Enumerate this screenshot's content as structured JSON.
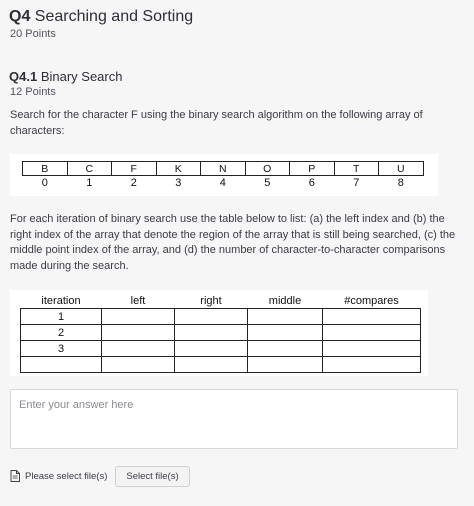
{
  "question": {
    "number": "Q4",
    "title": "Searching and Sorting",
    "points": "20 Points"
  },
  "subquestion": {
    "number": "Q4.1",
    "title": "Binary Search",
    "points": "12 Points"
  },
  "prompt_1": "Search for the character F using the binary search algorithm on the following array of characters:",
  "array": {
    "chars": [
      "B",
      "C",
      "F",
      "K",
      "N",
      "O",
      "P",
      "T",
      "U"
    ],
    "indices": [
      "0",
      "1",
      "2",
      "3",
      "4",
      "5",
      "6",
      "7",
      "8"
    ]
  },
  "prompt_2": "For each iteration of binary search use the table below to list: (a) the left index and (b) the right index of the array that denote the region of the array that is still being searched, (c) the middle point index of the array, and (d) the number of character-to-character comparisons made during the search.",
  "iteration_table": {
    "headers": [
      "iteration",
      "left",
      "right",
      "middle",
      "#compares"
    ],
    "rows": [
      [
        "1",
        "",
        "",
        "",
        ""
      ],
      [
        "2",
        "",
        "",
        "",
        ""
      ],
      [
        "3",
        "",
        "",
        "",
        ""
      ],
      [
        "",
        "",
        "",
        "",
        ""
      ]
    ]
  },
  "answer": {
    "placeholder": "Enter your answer here"
  },
  "upload": {
    "label": "Please select file(s)",
    "button": "Select file(s)",
    "icon": "file-icon"
  }
}
